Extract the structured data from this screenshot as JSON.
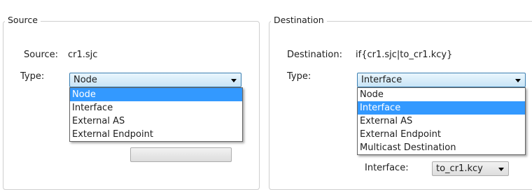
{
  "source": {
    "group_title": "Source",
    "source_label": "Source:",
    "source_value": "cr1.sjc",
    "type_label": "Type:",
    "type_selected": "Node",
    "options": [
      "Node",
      "Interface",
      "External AS",
      "External Endpoint"
    ],
    "selected_index": 0
  },
  "destination": {
    "group_title": "Destination",
    "destination_label": "Destination:",
    "destination_value": "if{cr1.sjc|to_cr1.kcy}",
    "type_label": "Type:",
    "type_selected": "Interface",
    "options": [
      "Node",
      "Interface",
      "External AS",
      "External Endpoint",
      "Multicast Destination"
    ],
    "selected_index": 1,
    "interface_label": "Interface:",
    "interface_value": "to_cr1.kcy"
  },
  "colors": {
    "selection": "#3399ff",
    "combo_border": "#3c7fb1"
  }
}
